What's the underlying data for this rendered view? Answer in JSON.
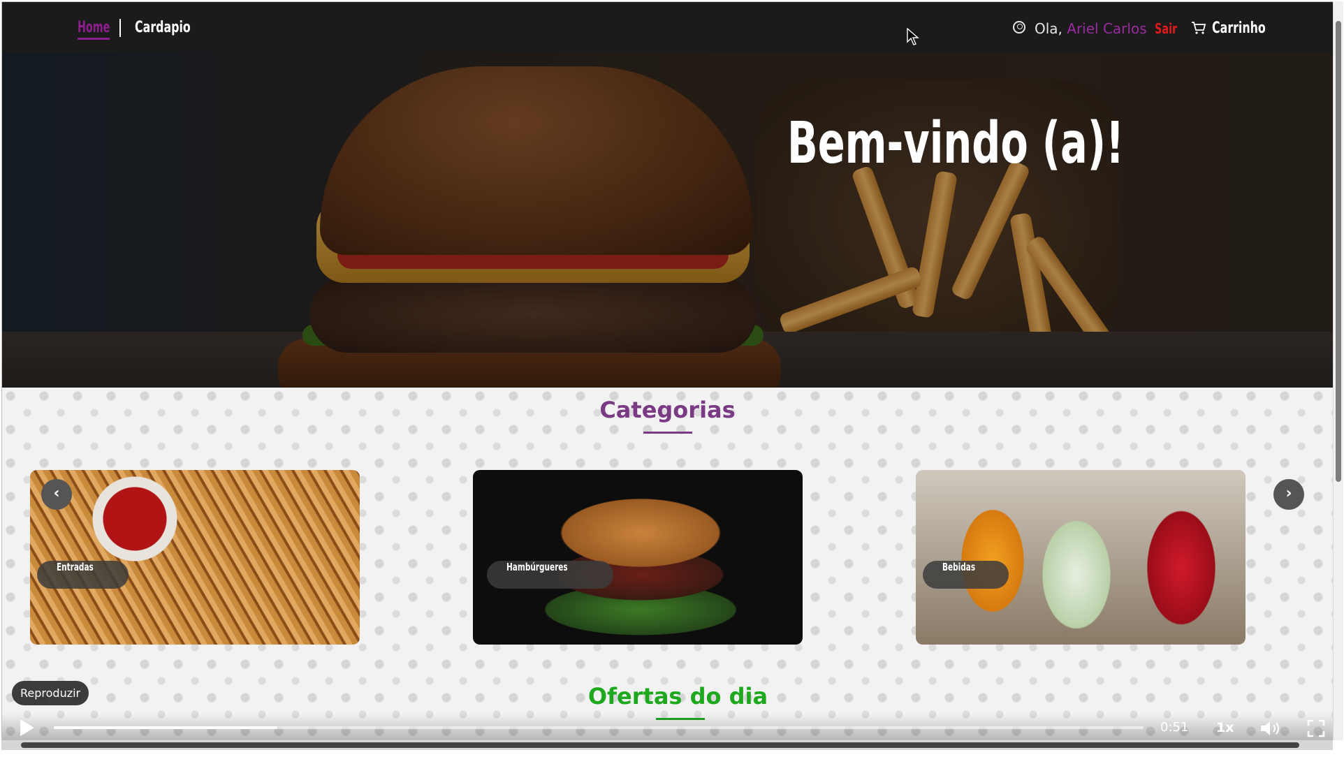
{
  "nav": {
    "home": "Home",
    "cardapio": "Cardapio",
    "greeting": "Ola, ",
    "user_name": "Ariel Carlos",
    "logout": "Sair",
    "cart": "Carrinho"
  },
  "hero": {
    "title": "Bem-vindo (a)!"
  },
  "categories": {
    "title": "Categorias",
    "items": [
      {
        "label": "Entradas"
      },
      {
        "label": "Hambúrgueres"
      },
      {
        "label": "Bebidas"
      }
    ]
  },
  "offers": {
    "title": "Ofertas do dia"
  },
  "video": {
    "play_tooltip": "Reproduzir",
    "time": "0:51",
    "speed": "1x",
    "progress_fraction": 0.205
  },
  "colors": {
    "accent_purple": "#8e1d8e",
    "logout_red": "#e11a1a",
    "offers_green": "#1ea81e"
  },
  "icons": [
    "user-circle-icon",
    "cart-icon",
    "chevron-left-icon",
    "chevron-right-icon",
    "play-icon",
    "volume-icon",
    "fullscreen-icon",
    "mouse-cursor-icon"
  ]
}
